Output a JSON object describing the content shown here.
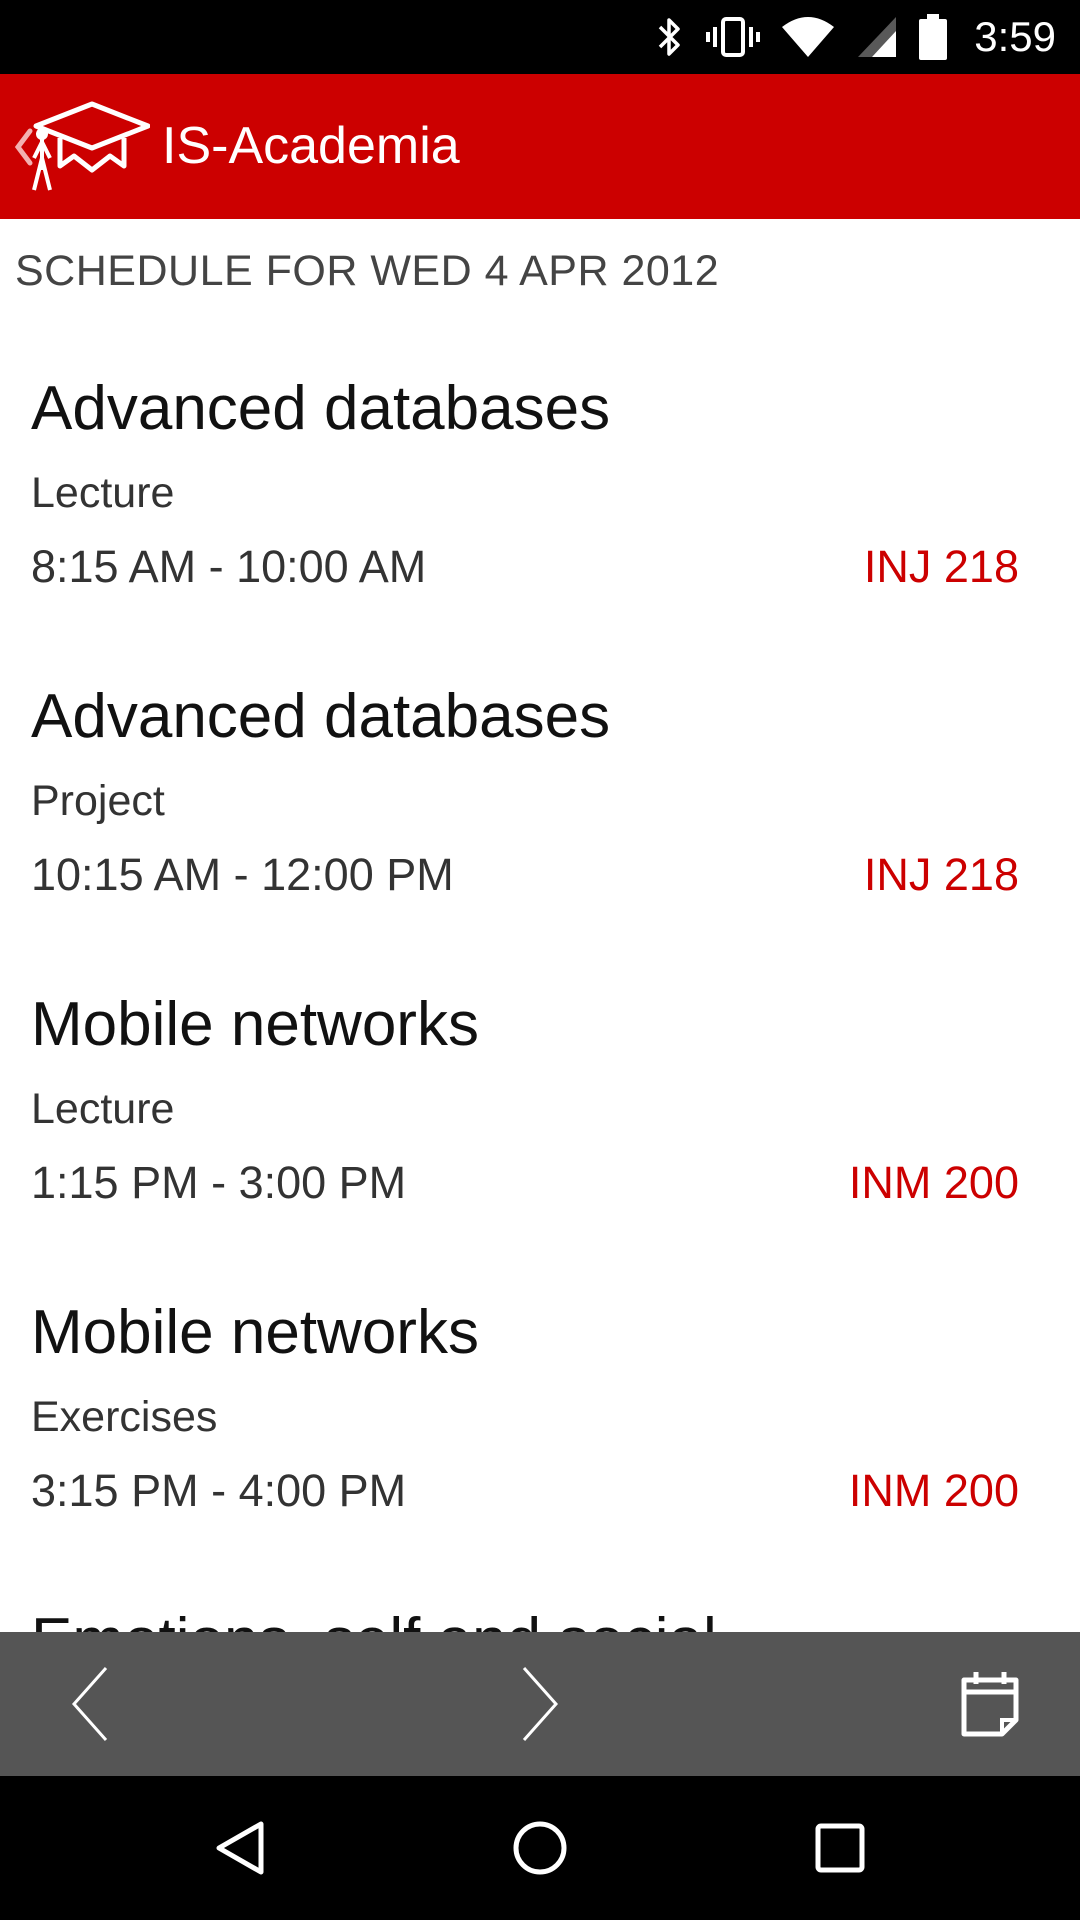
{
  "status_bar": {
    "time": "3:59",
    "icons": [
      "bluetooth-icon",
      "vibrate-icon",
      "wifi-icon",
      "cell-signal-icon",
      "battery-icon"
    ]
  },
  "app_bar": {
    "title": "IS-Academia",
    "logo": "graduation-cap-logo",
    "brand_color": "#cc0000"
  },
  "schedule": {
    "header": "SCHEDULE FOR WED 4 APR 2012",
    "entries": [
      {
        "course": "Advanced databases",
        "type": "Lecture",
        "time": "8:15 AM - 10:00 AM",
        "room": "INJ 218"
      },
      {
        "course": "Advanced databases",
        "type": "Project",
        "time": "10:15 AM - 12:00 PM",
        "room": "INJ 218"
      },
      {
        "course": "Mobile networks",
        "type": "Lecture",
        "time": "1:15 PM - 3:00 PM",
        "room": "INM 200"
      },
      {
        "course": "Mobile networks",
        "type": "Exercises",
        "time": "3:15 PM - 4:00 PM",
        "room": "INM 200"
      },
      {
        "course": "Emotions, self and social",
        "type": "",
        "time": "",
        "room": ""
      }
    ]
  },
  "action_bar": {
    "icons": [
      "previous-day-icon",
      "next-day-icon",
      "calendar-icon"
    ]
  },
  "nav_bar": {
    "icons": [
      "back-icon",
      "home-icon",
      "recents-icon"
    ]
  }
}
